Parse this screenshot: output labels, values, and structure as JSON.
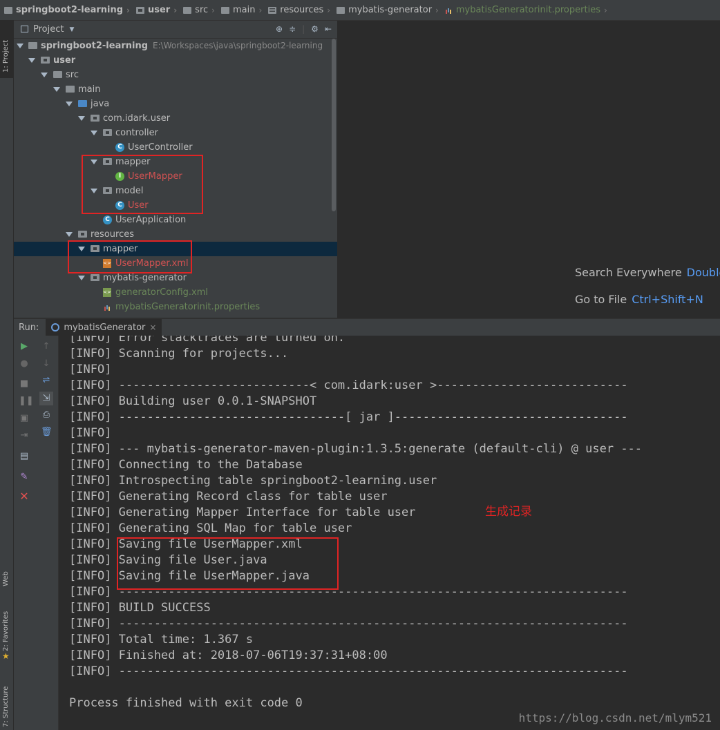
{
  "breadcrumb": [
    "springboot2-learning",
    "user",
    "src",
    "main",
    "resources",
    "mybatis-generator",
    "mybatisGeneratorinit.properties"
  ],
  "left_strip": {
    "project_tab": "1: Project",
    "web_tab": "Web",
    "favorites_tab": "2: Favorites",
    "structure_tab": "7: Structure"
  },
  "project_pane": {
    "title": "Project"
  },
  "tree": [
    {
      "label": "springboot2-learning",
      "path": "E:\\Workspaces\\java\\springboot2-learning"
    },
    {
      "label": "user"
    },
    {
      "label": "src"
    },
    {
      "label": "main"
    },
    {
      "label": "java"
    },
    {
      "label": "com.idark.user"
    },
    {
      "label": "controller"
    },
    {
      "label": "UserController"
    },
    {
      "label": "mapper"
    },
    {
      "label": "UserMapper"
    },
    {
      "label": "model"
    },
    {
      "label": "User"
    },
    {
      "label": "UserApplication"
    },
    {
      "label": "resources"
    },
    {
      "label": "mapper"
    },
    {
      "label": "UserMapper.xml"
    },
    {
      "label": "mybatis-generator"
    },
    {
      "label": "generatorConfig.xml"
    },
    {
      "label": "mybatisGeneratorinit.properties"
    }
  ],
  "editor_hints": {
    "search_label": "Search Everywhere",
    "search_key": "Double",
    "goto_label": "Go to File",
    "goto_key": "Ctrl+Shift+N"
  },
  "run_panel": {
    "label": "Run:",
    "tab": "mybatisGenerator"
  },
  "console": [
    "[INFO] Error stacktraces are turned on.",
    "[INFO] Scanning for projects...",
    "[INFO]",
    "[INFO] ---------------------------< com.idark:user >---------------------------",
    "[INFO] Building user 0.0.1-SNAPSHOT",
    "[INFO] --------------------------------[ jar ]---------------------------------",
    "[INFO]",
    "[INFO] --- mybatis-generator-maven-plugin:1.3.5:generate (default-cli) @ user ---",
    "[INFO] Connecting to the Database",
    "[INFO] Introspecting table springboot2-learning.user",
    "[INFO] Generating Record class for table user",
    "[INFO] Generating Mapper Interface for table user",
    "[INFO] Generating SQL Map for table user",
    "[INFO] Saving file UserMapper.xml",
    "[INFO] Saving file User.java",
    "[INFO] Saving file UserMapper.java",
    "[INFO] ------------------------------------------------------------------------",
    "[INFO] BUILD SUCCESS",
    "[INFO] ------------------------------------------------------------------------",
    "[INFO] Total time: 1.367 s",
    "[INFO] Finished at: 2018-07-06T19:37:31+08:00",
    "[INFO] ------------------------------------------------------------------------",
    "",
    "Process finished with exit code 0"
  ],
  "annotation": "生成记录",
  "watermark": "https://blog.csdn.net/mlym521",
  "colors": {
    "accent": "#589df6",
    "highlight_box": "#e02424",
    "selection": "#0d293e",
    "generated_file": "#d25252"
  }
}
